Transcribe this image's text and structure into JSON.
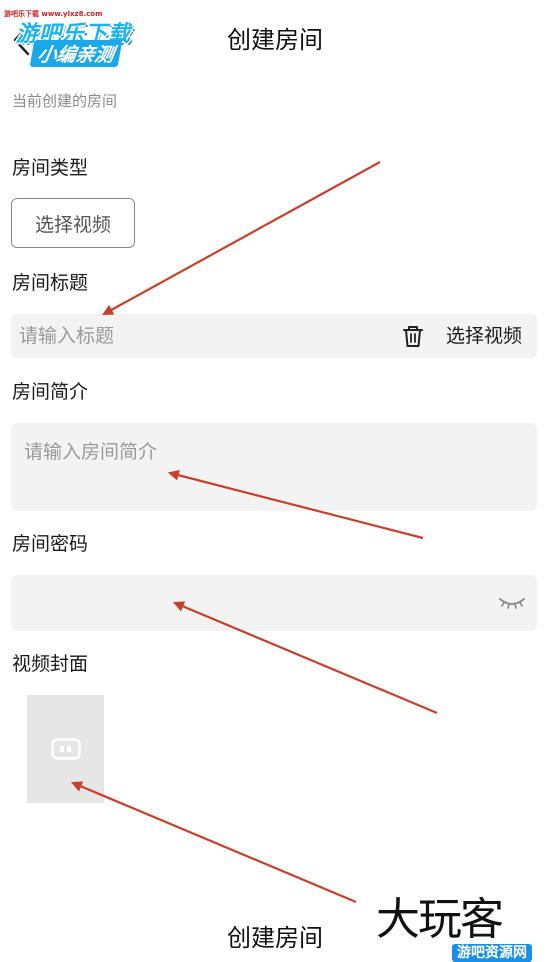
{
  "header": {
    "title": "创建房间",
    "back_icon": "chevron-left-icon"
  },
  "watermark_top": {
    "tiny": "游吧乐下载 www.ylxz8.com",
    "line1": "游吧乐下载",
    "line2": "小编亲测"
  },
  "subtitle": "当前创建的房间",
  "room_type": {
    "label": "房间类型",
    "button_label": "选择视频"
  },
  "room_title": {
    "label": "房间标题",
    "placeholder": "请输入标题",
    "trash_icon": "trash-icon",
    "select_label": "选择视频"
  },
  "room_intro": {
    "label": "房间简介",
    "placeholder": "请输入房间简介"
  },
  "room_password": {
    "label": "房间密码",
    "value": "",
    "eye_icon": "eye-closed-icon"
  },
  "video_cover": {
    "label": "视频封面",
    "icon": "video-placeholder-icon"
  },
  "create_button": {
    "label": "创建房间"
  },
  "watermark_bottom": {
    "big": "大玩客",
    "small": "游吧资源网"
  },
  "colors": {
    "arrow": "#c8402a",
    "input_bg": "#f3f3f3",
    "placeholder": "#9a9a9a",
    "cover_bg": "#e6e6e6"
  }
}
